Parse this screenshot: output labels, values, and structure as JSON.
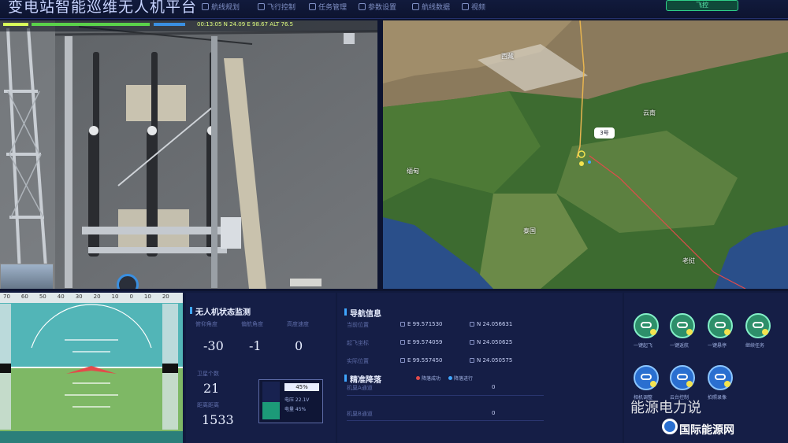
{
  "header": {
    "title": "变电站智能巡维无人机平台",
    "nav": [
      "航线规划",
      "飞行控制",
      "任务管理",
      "参数设置",
      "航线数据",
      "视频"
    ],
    "action_label": "飞控"
  },
  "video": {
    "telemetry_text": "00:13:05 N 24.09 E 98.67 ALT 76.5"
  },
  "map": {
    "place_labels": [
      "西藏",
      "缅甸",
      "泰国",
      "老挝",
      "云南"
    ],
    "badge_text": "3号"
  },
  "attitude": {
    "scale_top": [
      "70",
      "60",
      "50",
      "40",
      "30",
      "20",
      "10",
      "0",
      "10",
      "20"
    ]
  },
  "drone_status": {
    "title": "无人机状态监测",
    "metrics": [
      {
        "label": "俯仰角度",
        "value": "-30"
      },
      {
        "label": "偏航角度",
        "value": "-1"
      },
      {
        "label": "高度速度",
        "value": "0"
      },
      {
        "label": "卫星个数",
        "value": "21"
      },
      {
        "label": "距离距离",
        "value": "1533"
      }
    ],
    "battery": {
      "percent": 45,
      "percent_label": "45%",
      "lines": [
        "电压 22.1V",
        "电量 45%"
      ],
      "colors": {
        "charged": "#1c9a78",
        "empty": "#182250"
      }
    }
  },
  "comm": {
    "title": "导航信息",
    "rows": [
      {
        "label": "当前位置",
        "a": "E 99.571530",
        "b": "N 24.056631"
      },
      {
        "label": "起飞坐标",
        "a": "E 99.574059",
        "b": "N 24.050625"
      },
      {
        "label": "实际位置",
        "a": "E 99.557450",
        "b": "N 24.050575"
      }
    ],
    "section2_title": "精准降落",
    "legend": [
      {
        "label": "降落成功",
        "color": "#e24b4b"
      },
      {
        "label": "降落进行",
        "color": "#3fa6ff"
      }
    ],
    "land_rows": [
      {
        "label": "机巢A通道",
        "value": "0"
      },
      {
        "label": "机巢B通道",
        "value": "0"
      }
    ]
  },
  "controls": {
    "buttons": [
      {
        "label": "一键起飞"
      },
      {
        "label": "一键返航"
      },
      {
        "label": "一键悬停"
      },
      {
        "label": "继续任务"
      },
      {
        "label": "相机调整"
      },
      {
        "label": "云台控制"
      },
      {
        "label": "拍照录像"
      }
    ],
    "watermark": "能源电力说",
    "watermark2": "国际能源网"
  },
  "colors": {
    "panel_bg": "#151e46",
    "accent": "#3fa6ff",
    "btn_fill": "#2d8f6a",
    "btn_fill_blue": "#2a6fd0"
  }
}
